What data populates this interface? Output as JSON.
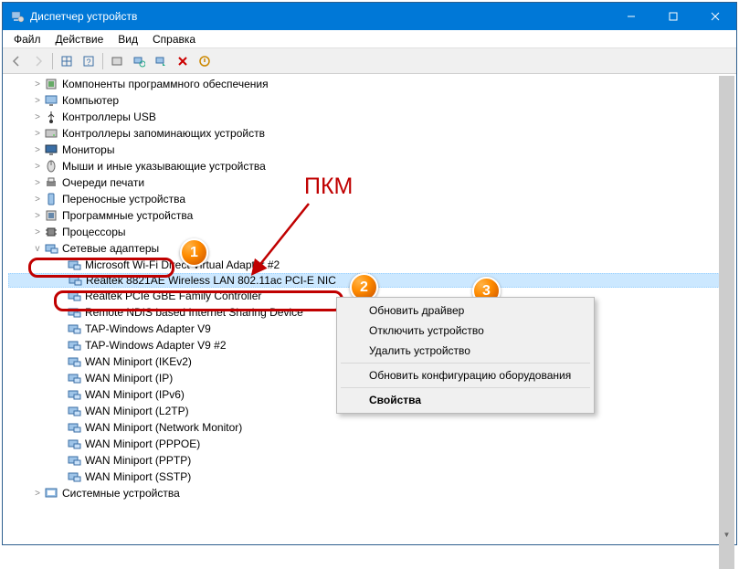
{
  "titlebar": {
    "title": "Диспетчер устройств"
  },
  "menu": {
    "file": "Файл",
    "action": "Действие",
    "view": "Вид",
    "help": "Справка"
  },
  "tree": {
    "top_categories": [
      "Компоненты программного обеспечения",
      "Компьютер",
      "Контроллеры USB",
      "Контроллеры запоминающих устройств",
      "Мониторы",
      "Мыши и иные указывающие устройства",
      "Очереди печати",
      "Переносные устройства",
      "Программные устройства",
      "Процессоры"
    ],
    "net_cat": "Сетевые адаптеры",
    "net": [
      "Microsoft Wi-Fi Direct Virtual Adapter #2",
      "Realtek 8821AE Wireless LAN 802.11ac PCI-E NIC",
      "Realtek PCIe GBE Family Controller",
      "Remote NDIS based Internet Sharing Device",
      "TAP-Windows Adapter V9",
      "TAP-Windows Adapter V9 #2",
      "WAN Miniport (IKEv2)",
      "WAN Miniport (IP)",
      "WAN Miniport (IPv6)",
      "WAN Miniport (L2TP)",
      "WAN Miniport (Network Monitor)",
      "WAN Miniport (PPPOE)",
      "WAN Miniport (PPTP)",
      "WAN Miniport (SSTP)"
    ],
    "sys_cat": "Системные устройства"
  },
  "context": {
    "update": "Обновить драйвер",
    "disable": "Отключить устройство",
    "uninstall": "Удалить устройство",
    "scan": "Обновить конфигурацию оборудования",
    "props": "Свойства"
  },
  "annot": {
    "pkm": "ПКМ",
    "b1": "1",
    "b2": "2",
    "b3": "3"
  }
}
